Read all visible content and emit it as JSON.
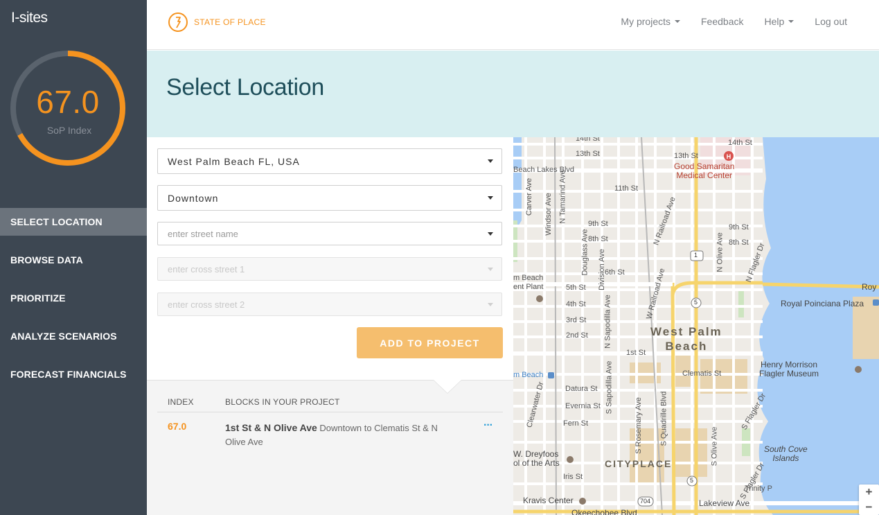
{
  "sidebar": {
    "brand": "I-sites",
    "gauge": {
      "value": "67.0",
      "label": "SoP Index",
      "fraction": 0.67,
      "color": "#f5931f"
    },
    "items": [
      {
        "label": "SELECT LOCATION",
        "active": true
      },
      {
        "label": "BROWSE DATA"
      },
      {
        "label": "PRIORITIZE"
      },
      {
        "label": "ANALYZE SCENARIOS"
      },
      {
        "label": "FORECAST FINANCIALS"
      }
    ]
  },
  "topbar": {
    "logo_text": "STATE OF PLACE",
    "nav": [
      {
        "label": "My projects",
        "dropdown": true
      },
      {
        "label": "Feedback"
      },
      {
        "label": "Help",
        "dropdown": true
      },
      {
        "label": "Log out"
      }
    ]
  },
  "header": {
    "title": "Select Location"
  },
  "form": {
    "city": "West Palm Beach FL, USA",
    "neighborhood": "Downtown",
    "street_placeholder": "enter street name",
    "cross1_placeholder": "enter cross street 1",
    "cross2_placeholder": "enter cross street 2",
    "add_button": "ADD TO PROJECT"
  },
  "blocks": {
    "headers": {
      "index": "INDEX",
      "blocks": "BLOCKS IN YOUR PROJECT"
    },
    "rows": [
      {
        "index": "67.0",
        "title": "1st St & N Olive Ave",
        "detail": "Downtown to Clematis St & N Olive Ave",
        "more": "···"
      }
    ]
  },
  "map": {
    "labels": {
      "st14": "14th St",
      "st14b": "14th St",
      "st13": "13th St",
      "st13b": "13th St",
      "beach_lakes": "Beach Lakes Blvd",
      "st11": "11th St",
      "hospital": "Good Samaritan\nMedical Center",
      "carver": "Carver Ave",
      "windsor": "Windsor Ave",
      "tamarind": "N Tamarind Ave",
      "st9": "9th St",
      "st8": "8th St",
      "st9b": "9th St",
      "st8b": "8th St",
      "douglass": "Douglass Ave",
      "division": "Division Ave",
      "st6": "6th St",
      "st5": "5th St",
      "st4": "4th St",
      "st3": "3rd St",
      "st2": "2nd St",
      "st1": "1st St",
      "plant": "m Beach\nent Plant",
      "nrailroad": "N Railroad Ave",
      "wrailroad": "W Railroad Ave",
      "nolive": "N Olive Ave",
      "nflagler": "N Flagler Dr",
      "royal": "Royal Poinciana Plaza",
      "roy": "Roy",
      "wpb": "West Palm\nBeach",
      "clematis": "Clematis St",
      "mbeach": "m Beach",
      "clearwater": "Clearwater Dr",
      "sapodilla": "N Sapodilla Ave",
      "datura": "Datura St",
      "evernia": "Evernia St",
      "fern": "Fern St",
      "ssapodilla": "S Sapodilla Ave",
      "rosemary": "S Rosemary Ave",
      "quadrille": "S Quadrille Blvd",
      "solive": "S Olive Ave",
      "sflagler": "S Flagler Dr",
      "sflagler2": "S Flagler Dr",
      "flagler_museum": "Henry Morrison\nFlagler Museum",
      "dreyfoos": "W. Dreyfoos\nol of the Arts",
      "iris": "Iris St",
      "cityplace": "CITYPLACE",
      "south_cove": "South Cove\nIslands",
      "trinity": "Trinity P",
      "kravis": "Kravis Center",
      "lakeview": "Lakeview Ave",
      "okeechobee": "Okeechobee Blvd",
      "route1": "1",
      "route5a": "5",
      "route5b": "5",
      "route704": "704"
    },
    "zoom_in": "+",
    "zoom_out": "−"
  }
}
